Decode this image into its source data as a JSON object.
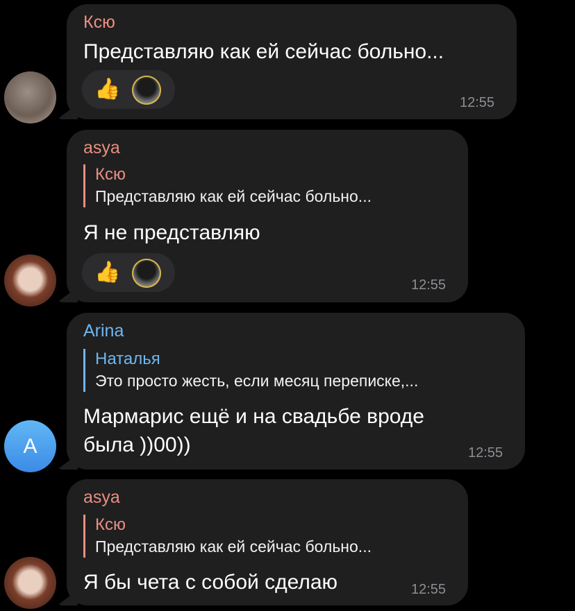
{
  "messages": [
    {
      "sender": "Ксю",
      "sender_color": "#e98f7f",
      "text": "Представляю как ей сейчас  больно...",
      "time": "12:55",
      "reactions": [
        "thumbs-up",
        "user-avatar"
      ]
    },
    {
      "sender": "asya",
      "sender_color": "#e98f7f",
      "reply": {
        "name": "Ксю",
        "text": "Представляю как ей сейчас  больно..."
      },
      "text": "Я не представляю",
      "time": "12:55",
      "reactions": [
        "thumbs-up",
        "user-avatar"
      ]
    },
    {
      "sender": "Arina",
      "sender_color": "#6fb6f0",
      "avatar_letter": "A",
      "reply": {
        "name": "Наталья",
        "text": "Это просто жесть, если месяц переписке,..."
      },
      "text_line1": "Мармарис ещё и на свадьбе вроде",
      "text_line2": "была ))00))",
      "time": "12:55"
    },
    {
      "sender": "asya",
      "sender_color": "#e98f7f",
      "reply": {
        "name": "Ксю",
        "text": "Представляю как ей сейчас  больно..."
      },
      "text": "Я бы чета с собой сделаю",
      "time": "12:55"
    }
  ]
}
